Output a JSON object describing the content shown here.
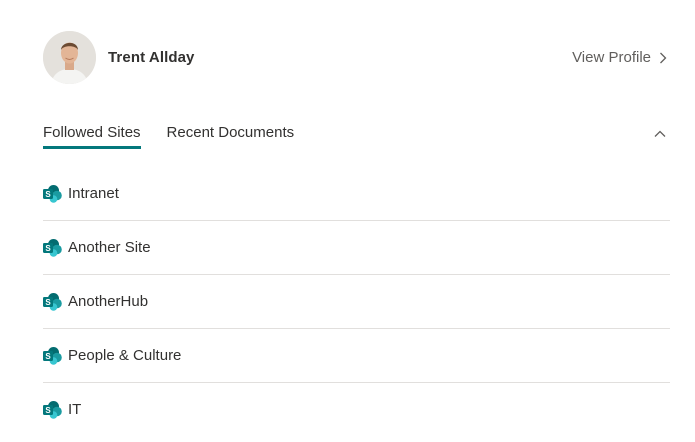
{
  "profile": {
    "name": "Trent Allday",
    "view_profile_label": "View Profile"
  },
  "tabs": [
    {
      "label": "Followed Sites",
      "active": true
    },
    {
      "label": "Recent Documents",
      "active": false
    }
  ],
  "sites": [
    {
      "label": "Intranet",
      "icon": "sharepoint-icon"
    },
    {
      "label": "Another Site",
      "icon": "sharepoint-icon"
    },
    {
      "label": "AnotherHub",
      "icon": "sharepoint-icon"
    },
    {
      "label": "People & Culture",
      "icon": "sharepoint-icon"
    },
    {
      "label": "IT",
      "icon": "sharepoint-icon"
    }
  ],
  "colors": {
    "accent": "#03787c",
    "text": "#323130",
    "secondary_text": "#605e5c",
    "divider": "#e1dfdd"
  }
}
